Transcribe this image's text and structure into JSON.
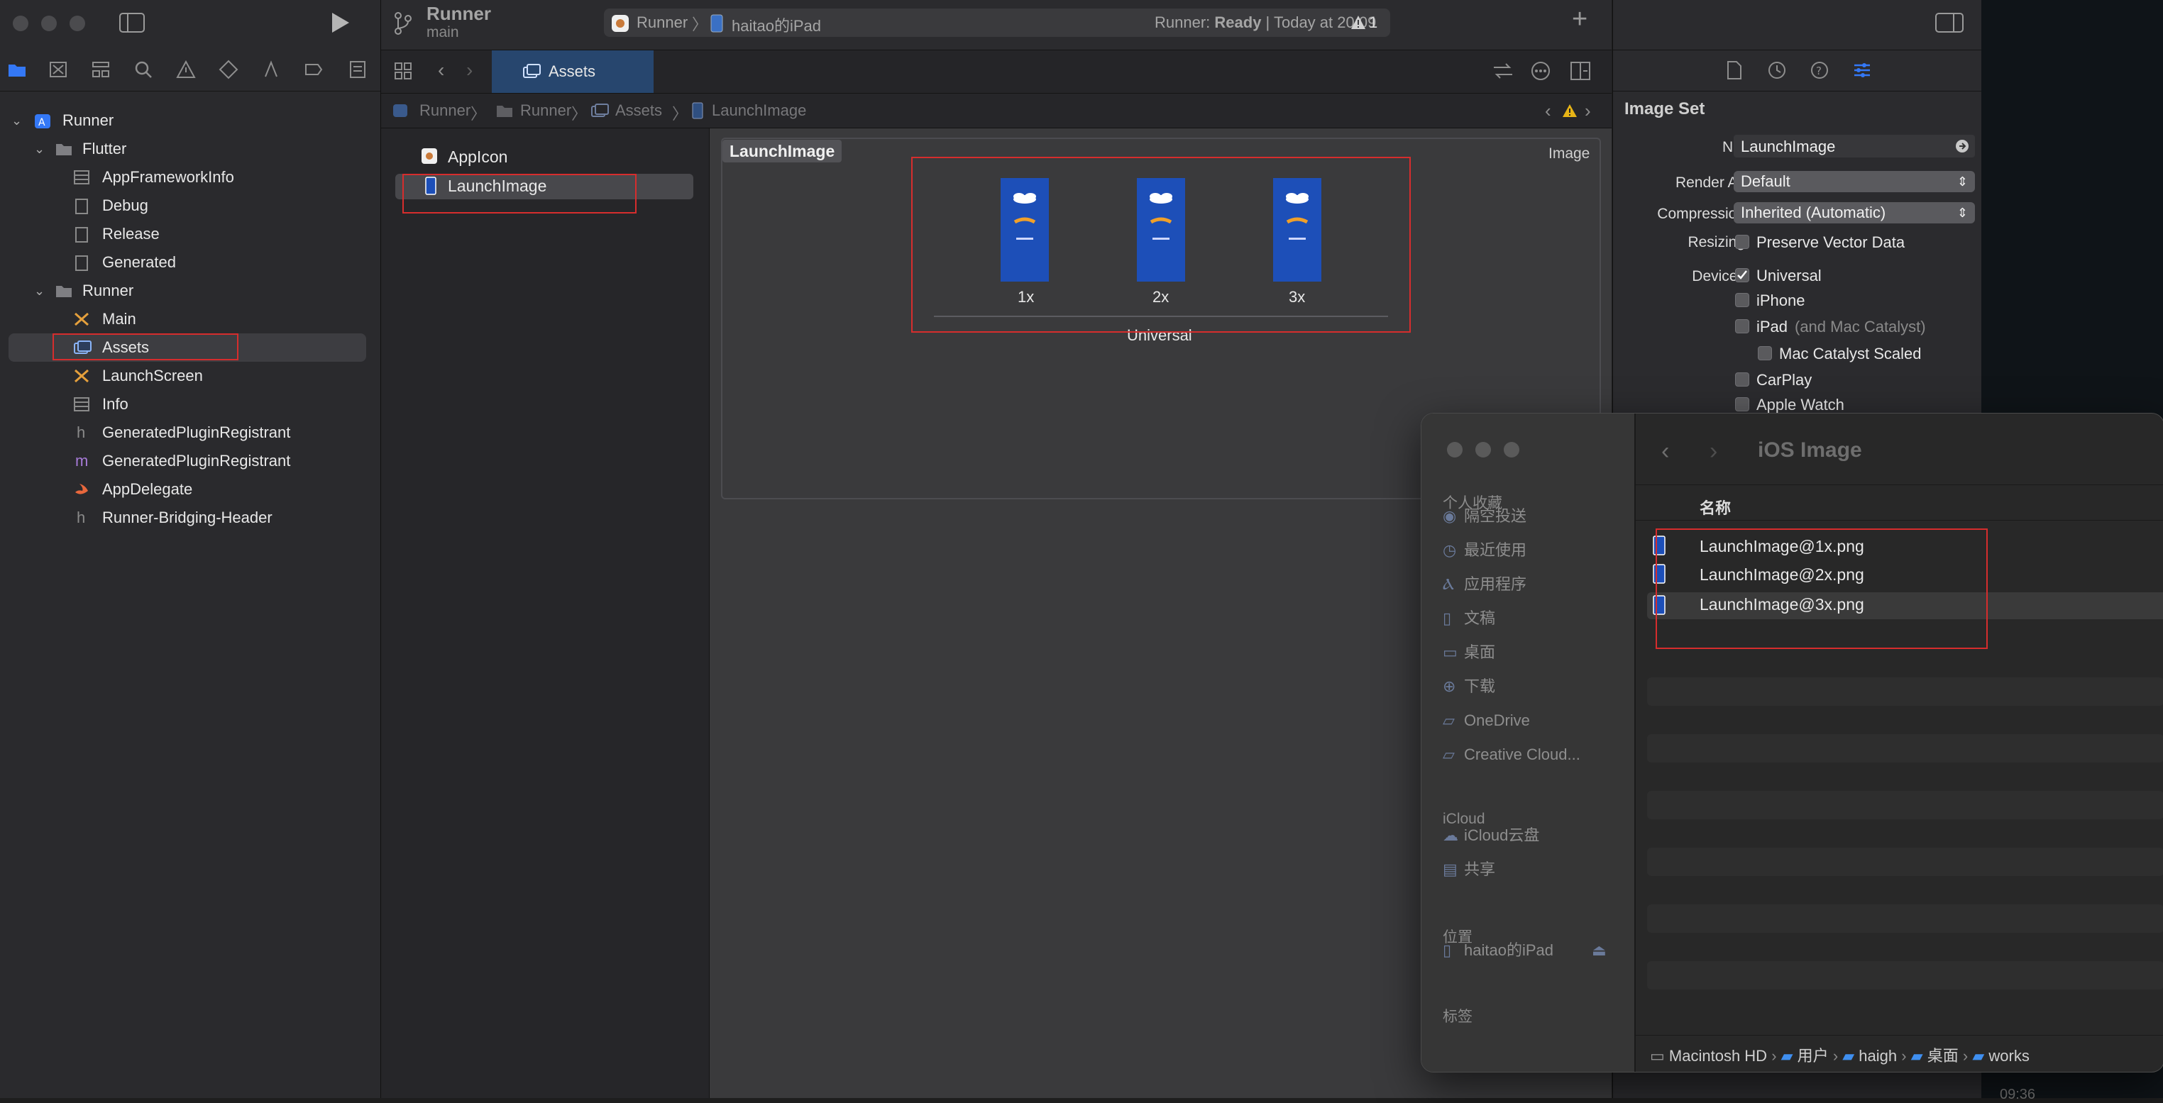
{
  "toolbar": {
    "project_name": "Runner",
    "branch": "main",
    "scheme": "Runner",
    "destination": "haitao的iPad",
    "status_prefix": "Runner: ",
    "status_state": "Ready",
    "status_time": " | Today at 20:09",
    "warning_count": "1",
    "add_label": "+"
  },
  "navigator": {
    "items": [
      {
        "label": "Runner"
      },
      {
        "label": "Flutter"
      },
      {
        "label": "AppFrameworkInfo"
      },
      {
        "label": "Debug"
      },
      {
        "label": "Release"
      },
      {
        "label": "Generated"
      },
      {
        "label": "Runner"
      },
      {
        "label": "Main"
      },
      {
        "label": "Assets"
      },
      {
        "label": "LaunchScreen"
      },
      {
        "label": "Info"
      },
      {
        "label": "GeneratedPluginRegistrant"
      },
      {
        "label": "GeneratedPluginRegistrant"
      },
      {
        "label": "AppDelegate"
      },
      {
        "label": "Runner-Bridging-Header"
      }
    ]
  },
  "editor": {
    "tab_label": "Assets",
    "jumpbar": [
      "Runner",
      "Runner",
      "Assets",
      "LaunchImage"
    ],
    "asset_list": [
      "AppIcon",
      "LaunchImage"
    ],
    "imageset": {
      "title": "LaunchImage",
      "type_label": "Image",
      "slots": [
        "1x",
        "2x",
        "3x"
      ],
      "group_label": "Universal"
    }
  },
  "inspector": {
    "title": "Image Set",
    "name_label": "Name",
    "name_value": "LaunchImage",
    "render_as_label": "Render As",
    "render_as_value": "Default",
    "compression_label": "Compression",
    "compression_value": "Inherited (Automatic)",
    "resizing_label": "Resizing",
    "preserve_vector": "Preserve Vector Data",
    "devices_label": "Devices",
    "devices": {
      "universal": "Universal",
      "iphone": "iPhone",
      "ipad": "iPad",
      "ipad_note": "(and Mac Catalyst)",
      "mac_catalyst": "Mac Catalyst Scaled",
      "carplay": "CarPlay",
      "apple_watch": "Apple Watch"
    }
  },
  "finder": {
    "title": "iOS Image",
    "column_name": "名称",
    "favorites_header": "个人收藏",
    "favorites": [
      "隔空投送",
      "最近使用",
      "应用程序",
      "文稿",
      "桌面",
      "下载",
      "OneDrive",
      "Creative Cloud..."
    ],
    "icloud_header": "iCloud",
    "icloud": [
      "iCloud云盘",
      "共享"
    ],
    "locations_header": "位置",
    "locations": [
      "haitao的iPad"
    ],
    "tags_header": "标签",
    "files": [
      "LaunchImage@1x.png",
      "LaunchImage@2x.png",
      "LaunchImage@3x.png"
    ],
    "path": [
      "Macintosh HD",
      "用户",
      "haigh",
      "桌面",
      "works"
    ]
  },
  "background_fragment": "09:36",
  "colors": {
    "accent": "#3478f6",
    "highlight_box": "#d62d2d",
    "launch_blue": "#1d4fb8",
    "warning": "#e7b416"
  }
}
